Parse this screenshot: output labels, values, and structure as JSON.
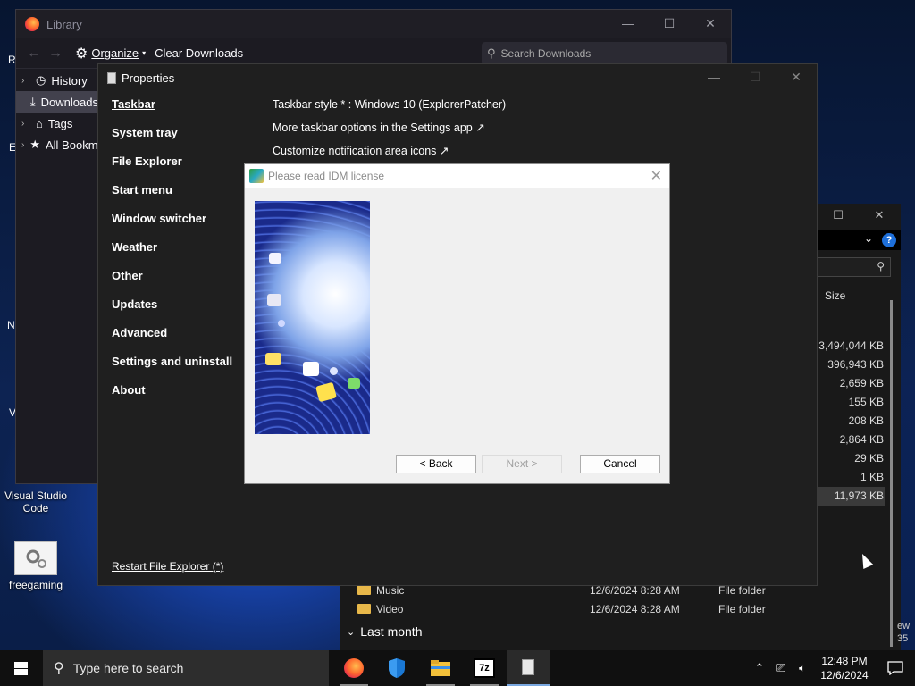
{
  "desktop": {
    "icons": [
      {
        "label": "Visual Studio Code",
        "icon": "vscode-icon"
      },
      {
        "label": "freegaming",
        "icon": "gear-shortcut-icon"
      }
    ],
    "partial_letters": [
      "R",
      "E",
      "N",
      "V"
    ]
  },
  "library": {
    "title": "Library",
    "toolbar": {
      "organize": "Organize",
      "clear_downloads": "Clear Downloads"
    },
    "search_placeholder": "Search Downloads",
    "sidebar": [
      {
        "label": "History",
        "icon": "clock-icon"
      },
      {
        "label": "Downloads",
        "icon": "download-icon"
      },
      {
        "label": "Tags",
        "icon": "tag-icon"
      },
      {
        "label": "All Bookmarks",
        "icon": "star-icon"
      }
    ]
  },
  "properties": {
    "title": "Properties",
    "nav": [
      "Taskbar",
      "System tray",
      "File Explorer",
      "Start menu",
      "Window switcher",
      "Weather",
      "Other",
      "Updates",
      "Advanced",
      "Settings and uninstall",
      "About"
    ],
    "active_nav": "Taskbar",
    "content": [
      "Taskbar style * : Windows 10 (ExplorerPatcher)",
      "More taskbar options in the Settings app ↗",
      "Customize notification area icons ↗"
    ],
    "restart_link": "Restart File Explorer (*)"
  },
  "explorer": {
    "column_size": "Size",
    "sizes": [
      "3,494,044 KB",
      "396,943 KB",
      "2,659 KB",
      "155 KB",
      "208 KB",
      "2,864 KB",
      "29 KB",
      "1 KB",
      "11,973 KB"
    ],
    "rows": [
      {
        "name": "Music",
        "date": "12/6/2024 8:28 AM",
        "type": "File folder"
      },
      {
        "name": "Video",
        "date": "12/6/2024 8:28 AM",
        "type": "File folder"
      }
    ],
    "group": "Last month",
    "edge_text": [
      "ew",
      "35"
    ]
  },
  "idm_dialog": {
    "title": "Please read IDM license",
    "buttons": {
      "back": "< Back",
      "next": "Next >",
      "cancel": "Cancel"
    }
  },
  "taskbar": {
    "search_placeholder": "Type here to search",
    "apps": [
      "firefox-icon",
      "windows-security-icon",
      "file-explorer-icon",
      "7zip-icon",
      "installer-icon"
    ],
    "clock": {
      "time": "12:48 PM",
      "date": "12/6/2024"
    }
  },
  "colors": {
    "accent": "#1e6fd9",
    "taskbar": "#101010",
    "dialog_bg": "#f0f0f0"
  }
}
